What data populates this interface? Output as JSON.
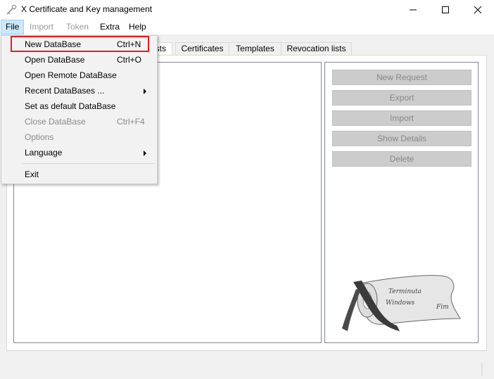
{
  "window": {
    "title": "X Certificate and Key management",
    "icon": "key-icon"
  },
  "menubar": {
    "file": "File",
    "import": "Import",
    "token": "Token",
    "extra": "Extra",
    "help": "Help"
  },
  "tabs": [
    {
      "label": "sts"
    },
    {
      "label": "Certificates"
    },
    {
      "label": "Templates"
    },
    {
      "label": "Revocation lists"
    }
  ],
  "side_buttons": {
    "new_request": "New Request",
    "export": "Export",
    "import": "Import",
    "show_details": "Show Details",
    "delete": "Delete"
  },
  "file_menu": {
    "items": [
      {
        "label": "New DataBase",
        "shortcut": "Ctrl+N"
      },
      {
        "label": "Open DataBase",
        "shortcut": "Ctrl+O"
      },
      {
        "label": "Open Remote DataBase",
        "shortcut": ""
      },
      {
        "label": "Recent DataBases ...",
        "shortcut": ""
      },
      {
        "label": "Set as default DataBase",
        "shortcut": ""
      },
      {
        "label": "Close DataBase",
        "shortcut": "Ctrl+F4"
      },
      {
        "label": "Options",
        "shortcut": ""
      },
      {
        "label": "Language",
        "shortcut": ""
      },
      {
        "label": "Exit",
        "shortcut": ""
      }
    ]
  },
  "scroll_art": {
    "line1": "Terminuta",
    "line2": "Windows",
    "line3": "Fim"
  },
  "colors": {
    "highlight": "#e02020",
    "menu_active": "#cce8ff"
  }
}
